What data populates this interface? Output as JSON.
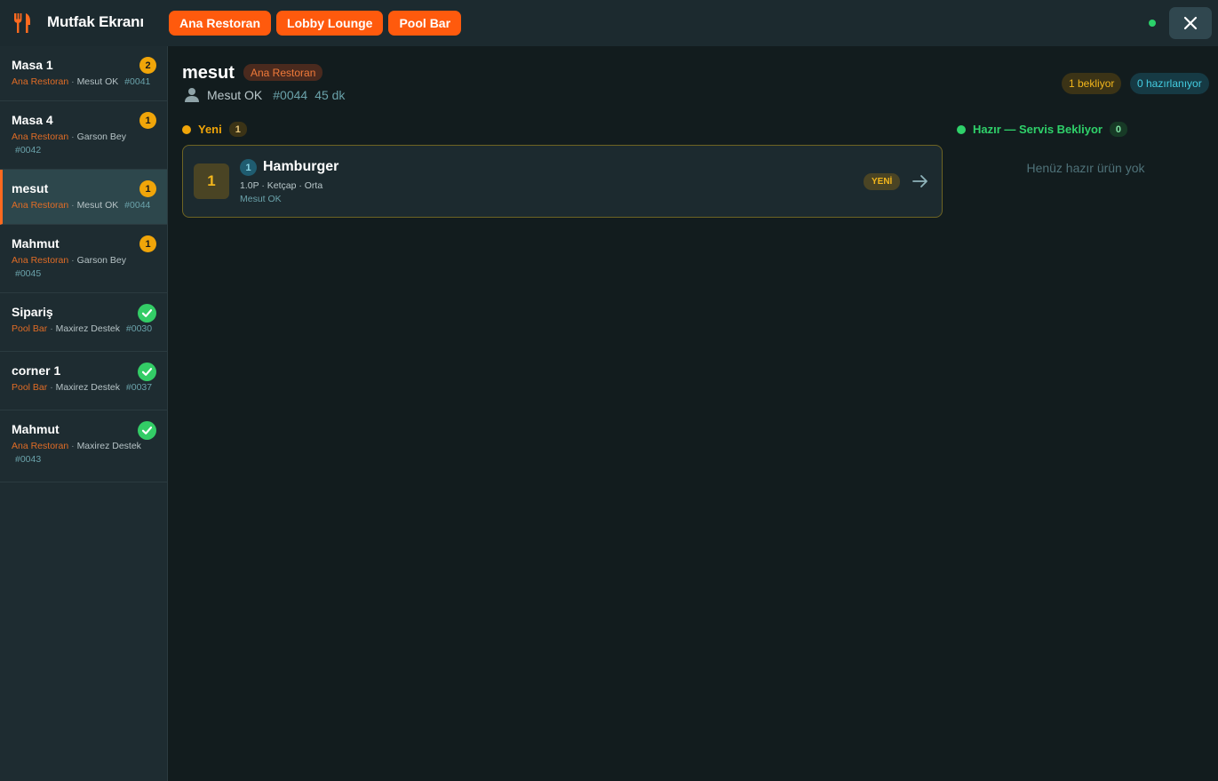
{
  "header": {
    "title": "Mutfak Ekranı",
    "logo_icon": "fork-knife-icon",
    "tabs": [
      {
        "label": "Ana Restoran"
      },
      {
        "label": "Lobby Lounge"
      },
      {
        "label": "Pool Bar"
      }
    ],
    "status_color": "#2bd16a",
    "close_icon": "close-icon"
  },
  "sidebar": {
    "orders": [
      {
        "name": "Masa 1",
        "restaurant": "Ana Restoran",
        "waiter": "Mesut OK",
        "number": "#0041",
        "count": "2"
      },
      {
        "name": "Masa 4",
        "restaurant": "Ana Restoran",
        "waiter": "Garson Bey",
        "number": "#0042",
        "count": "1"
      },
      {
        "name": "mesut",
        "restaurant": "Ana Restoran",
        "waiter": "Mesut OK",
        "number": "#0044",
        "count": "1"
      },
      {
        "name": "Mahmut",
        "restaurant": "Ana Restoran",
        "waiter": "Garson Bey",
        "number": "#0045",
        "count": "1"
      },
      {
        "name": "Sipariş",
        "restaurant": "Pool Bar",
        "waiter": "Maxirez Destek",
        "number": "#0030"
      },
      {
        "name": "corner 1",
        "restaurant": "Pool Bar",
        "waiter": "Maxirez Destek",
        "number": "#0037"
      },
      {
        "name": "Mahmut",
        "restaurant": "Ana Restoran",
        "waiter": "Maxirez Destek",
        "number": "#0043"
      }
    ],
    "separator": "·"
  },
  "detail": {
    "title": "mesut",
    "restaurant": "Ana Restoran",
    "waiter": "Mesut OK",
    "number": "#0044",
    "elapsed": "45 dk",
    "waiting_label": "1 bekliyor",
    "preparing_label": "0 hazırlanıyor",
    "new_section": {
      "label": "Yeni",
      "count": "1"
    },
    "ready_section": {
      "label": "Hazır — Servis Bekliyor",
      "count": "0",
      "empty_text": "Henüz hazır ürün yok"
    },
    "items": [
      {
        "qty": "1",
        "index": "1",
        "name": "Hamburger",
        "options": "1.0P · Ketçap · Orta",
        "waiter": "Mesut OK",
        "status": "YENİ"
      }
    ]
  },
  "colors": {
    "accent": "#ff5a0d",
    "pending": "#f0a509",
    "done": "#33cc66",
    "ready": "#2fd16a"
  }
}
